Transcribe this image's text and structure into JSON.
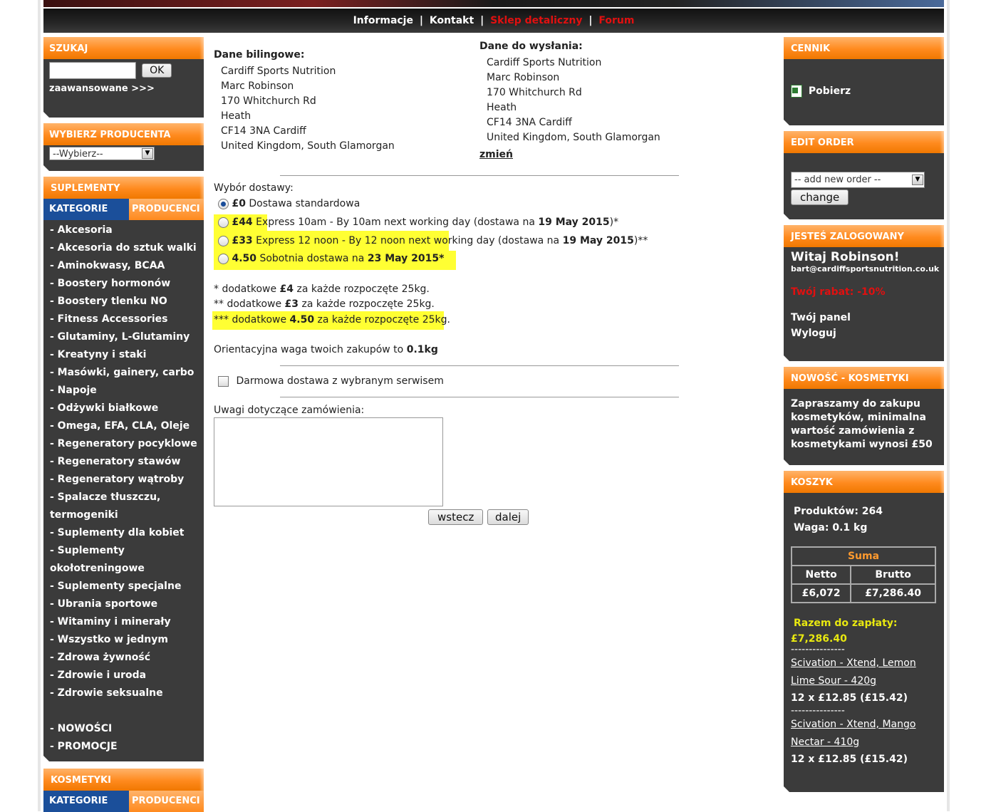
{
  "topnav": {
    "informacje": "Informacje",
    "kontakt": "Kontakt",
    "sklep": "Sklep detaliczny",
    "forum": "Forum",
    "sep": "|"
  },
  "left": {
    "search": {
      "title": "SZUKAJ",
      "button": "OK",
      "advanced": "zaawansowane >>>"
    },
    "producer": {
      "title": "WYBIERZ PRODUCENTA",
      "selected": "--Wybierz--"
    },
    "supplements": {
      "title": "SUPLEMENTY",
      "tab_categories": "KATEGORIE",
      "tab_producers": "PRODUCENCI",
      "items": [
        "- Akcesoria",
        "- Akcesoria do sztuk walki",
        "- Aminokwasy, BCAA",
        "- Boostery hormonów",
        "- Boostery tlenku NO",
        "- Fitness Accessories",
        "- Glutaminy, L-Glutaminy",
        "- Kreatyny i staki",
        "- Masówki, gainery, carbo",
        "- Napoje",
        "- Odżywki białkowe",
        "- Omega, EFA, CLA, Oleje",
        "- Regeneratory pocyklowe",
        "- Regeneratory stawów",
        "- Regeneratory wątroby",
        "- Spalacze tłuszczu,",
        "termogeniki",
        "- Suplementy dla kobiet",
        "- Suplementy",
        "okołotreningowe",
        "- Suplementy specjalne",
        "- Ubrania sportowe",
        "- Witaminy i minerały",
        "- Wszystko w jednym",
        "- Zdrowa żywność",
        "- Zdrowie i uroda",
        "- Zdrowie seksualne"
      ],
      "extra": [
        "- NOWOŚCI",
        "- PROMOCJE"
      ]
    },
    "cosmetics": {
      "title": "KOSMETYKI",
      "tab_categories": "KATEGORIE",
      "tab_producers": "PRODUCENCI"
    }
  },
  "main": {
    "billing": {
      "title": "Dane bilingowe:",
      "lines": [
        "Cardiff Sports Nutrition",
        "Marc Robinson",
        "170 Whitchurch Rd",
        "Heath",
        "CF14 3NA Cardiff",
        "United Kingdom, South Glamorgan"
      ]
    },
    "shipping": {
      "title": "Dane do wysłania:",
      "lines": [
        "Cardiff Sports Nutrition",
        "Marc Robinson",
        "170 Whitchurch Rd",
        "Heath",
        "CF14 3NA Cardiff",
        "United Kingdom, South Glamorgan"
      ],
      "change": "zmień"
    },
    "delivery": {
      "title": "Wybór dostawy:",
      "opt0": {
        "price": "£0",
        "text": " Dostawa standardowa"
      },
      "opt1": {
        "price": "£44",
        "text": " Express 10am - By 10am next working day (dostawa na ",
        "date": "19 May 2015",
        "suffix": ")*"
      },
      "opt2": {
        "price": "£33",
        "text": " Express 12 noon - By 12 noon next working day (dostawa na ",
        "date": "19 May 2015",
        "suffix": ")**"
      },
      "opt3": {
        "price": "4.50",
        "text": " Sobotnia dostawa na ",
        "date": "23 May 2015*"
      }
    },
    "notes": {
      "n1": {
        "pre": "* dodatkowe ",
        "val": "£4",
        "post": " za każde rozpoczęte 25kg."
      },
      "n2": {
        "pre": "** dodatkowe ",
        "val": "£3",
        "post": " za każde rozpoczęte 25kg."
      },
      "n3": {
        "pre": "*** dodatkowe ",
        "val": "4.50",
        "post": " za każde rozpoczęte 25kg."
      }
    },
    "weight": {
      "text": "Orientacyjna waga twoich zakupów to ",
      "value": "0.1kg"
    },
    "free_delivery": "Darmowa dostawa z wybranym serwisem",
    "remarks_label": "Uwagi dotyczące zamówienia:",
    "remarks_value": "",
    "back_button": "wstecz",
    "next_button": "dalej"
  },
  "right": {
    "pricelist": {
      "title": "CENNIK",
      "download": "Pobierz"
    },
    "edit_order": {
      "title": "EDIT ORDER",
      "selected": "-- add new order --",
      "button": "change"
    },
    "logged": {
      "title": "JESTEŚ ZALOGOWANY",
      "greeting": "Witaj Robinson!",
      "email": "bart@cardiffsportsnutrition.co.uk",
      "discount": "Twój rabat: -10%",
      "panel": "Twój panel",
      "logout": "Wyloguj"
    },
    "news": {
      "title": "NOWOŚĆ - KOSMETYKI",
      "text": "Zapraszamy do zakupu kosmetyków, minimalna wartość zamówienia z kosmetykami wynosi £50"
    },
    "cart": {
      "title": "KOSZYK",
      "products": "Produktów: 264",
      "weight": "Waga: 0.1 kg",
      "sum_label": "Suma",
      "netto_label": "Netto",
      "brutto_label": "Brutto",
      "netto": "£6,072",
      "brutto": "£7,286.40",
      "total_label": "Razem do zapłaty:",
      "total": "£7,286.40",
      "divider": "---------------",
      "item1": {
        "name": "Scivation - Xtend, Lemon Lime Sour - 420g",
        "qty": "12 x £12.85 (£15.42)"
      },
      "item2": {
        "name": "Scivation - Xtend, Mango Nectar - 410g",
        "qty": "12 x £12.85 (£15.42)"
      }
    }
  },
  "colors": {
    "orange": "#ff8a1e",
    "dark": "#3b3b3b",
    "blue_tab": "#1b4f9a",
    "highlight": "#ffff33",
    "red": "#e01010",
    "cart_yellow": "#e8e810"
  }
}
